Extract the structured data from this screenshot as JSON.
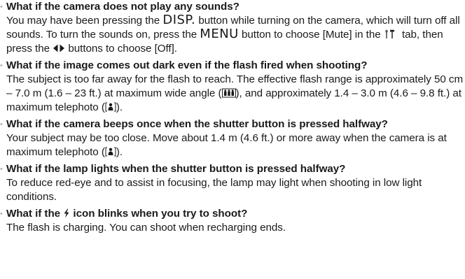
{
  "faq": {
    "bullet": "•",
    "items": [
      {
        "question": "What if the camera does not play any sounds?",
        "answer": {
          "p1": "You may have been pressing the ",
          "disp_label": "DISP.",
          "p2": " button while turning on the camera, which will turn off all sounds. To turn the sounds on, press the ",
          "menu_label": "MENU",
          "p3": " button to choose [Mute] in the ",
          "tab_icon": "wrench-hammer-tools-icon",
          "p4": " tab, then press the ",
          "buttons_icon": "left-right-arrows-icon",
          "p5": " buttons to choose [Off]."
        }
      },
      {
        "question": "What if the image comes out dark even if the flash fired when shooting?",
        "answer": {
          "p1": "The subject is too far away for the flash to reach. The effective flash range is approximately 50 cm – 7.0 m (1.6 – 23 ft.) at maximum wide angle (",
          "wide_icon": "wide-angle-icon",
          "p2": "), and approximately 1.4 – 3.0 m (4.6 – 9.8 ft.) at maximum telephoto (",
          "tele_icon": "telephoto-icon",
          "p3": ")."
        }
      },
      {
        "question": "What if the camera beeps once when the shutter button is pressed halfway?",
        "answer": {
          "p1": "Your subject may be too close. Move about 1.4 m (4.6 ft.) or more away when the camera is at maximum telephoto (",
          "tele_icon": "telephoto-icon",
          "p2": ")."
        }
      },
      {
        "question": "What if the lamp lights when the shutter button is pressed halfway?",
        "answer": {
          "text": "To reduce red-eye and to assist in focusing, the lamp may light when shooting in low light conditions."
        }
      },
      {
        "question": {
          "p1": "What if the ",
          "flash_icon": "flash-icon",
          "p2": " icon blinks when you try to shoot?"
        },
        "answer": {
          "text": "The flash is charging. You can shoot when recharging ends."
        }
      }
    ]
  }
}
